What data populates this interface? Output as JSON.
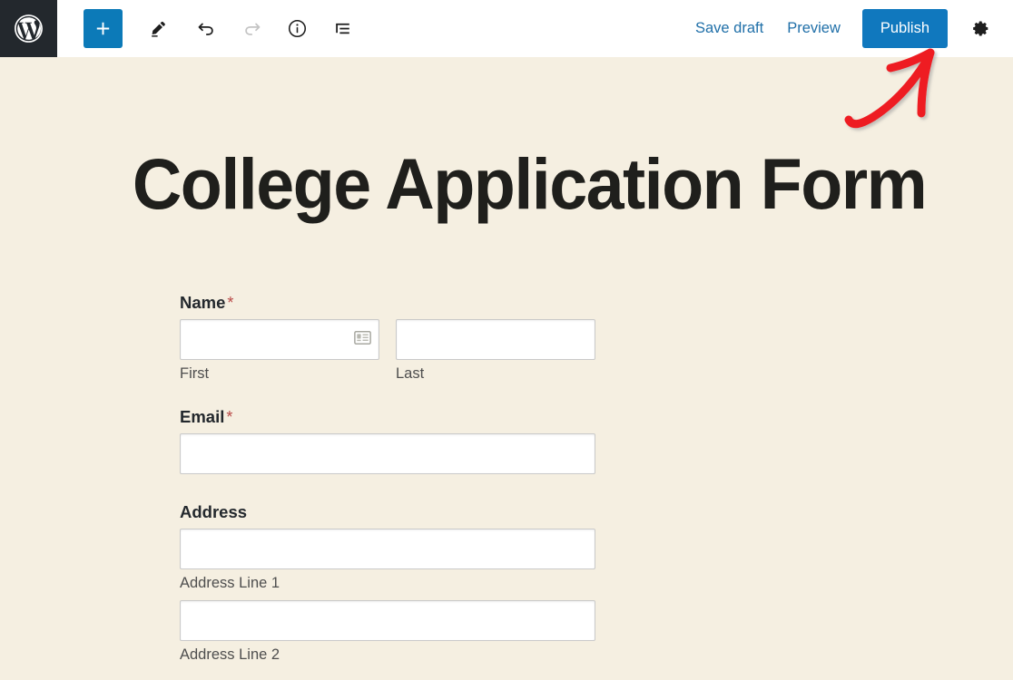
{
  "toolbar": {
    "logo_icon": "wordpress-logo-icon",
    "left_buttons": [
      {
        "name": "add-block-button",
        "icon": "plus-icon",
        "label": "Add block",
        "state": "enabled"
      },
      {
        "name": "edit-mode-button",
        "icon": "pencil-icon",
        "label": "Edit",
        "state": "enabled"
      },
      {
        "name": "undo-button",
        "icon": "undo-arrow-icon",
        "label": "Undo",
        "state": "enabled"
      },
      {
        "name": "redo-button",
        "icon": "redo-arrow-icon",
        "label": "Redo",
        "state": "disabled"
      },
      {
        "name": "details-button",
        "icon": "info-circle-icon",
        "label": "Details",
        "state": "enabled"
      },
      {
        "name": "list-view-button",
        "icon": "list-view-icon",
        "label": "List view",
        "state": "enabled"
      }
    ],
    "save_draft_label": "Save draft",
    "preview_label": "Preview",
    "publish_label": "Publish",
    "settings_icon": "gear-icon"
  },
  "colors": {
    "canvas_background": "#f5efe1",
    "toolbar_background": "#ffffff",
    "logo_block": "#23282d",
    "accent_blue": "#1078be",
    "link_blue": "#1f6fa8",
    "add_block_blue": "#0c7ab8",
    "annotation_red": "#ee1b24",
    "required_star": "#b94a48",
    "input_border": "#c9c9c9",
    "title_text": "#1f1f1c",
    "sub_label_text": "#4e4e4e"
  },
  "post": {
    "title": "College Application Form"
  },
  "form": {
    "fields": [
      {
        "name": "name",
        "label": "Name",
        "required": true,
        "required_marker": "*",
        "layout": "two-column",
        "inputs": [
          {
            "name": "first-name-input",
            "value": "",
            "placeholder": "",
            "sub_label": "First",
            "icon": "contact-card-icon"
          },
          {
            "name": "last-name-input",
            "value": "",
            "placeholder": "",
            "sub_label": "Last",
            "icon": ""
          }
        ]
      },
      {
        "name": "email",
        "label": "Email",
        "required": true,
        "required_marker": "*",
        "layout": "single",
        "inputs": [
          {
            "name": "email-input",
            "value": "",
            "placeholder": "",
            "sub_label": "",
            "icon": ""
          }
        ]
      },
      {
        "name": "address",
        "label": "Address",
        "required": false,
        "required_marker": "",
        "layout": "stacked",
        "inputs": [
          {
            "name": "address-line-1-input",
            "value": "",
            "placeholder": "",
            "sub_label": "Address Line 1",
            "icon": ""
          },
          {
            "name": "address-line-2-input",
            "value": "",
            "placeholder": "",
            "sub_label": "Address Line 2",
            "icon": ""
          }
        ]
      }
    ]
  },
  "annotation": {
    "type": "curved-arrow",
    "points_to": "publish-button",
    "color": "#ee1b24"
  }
}
